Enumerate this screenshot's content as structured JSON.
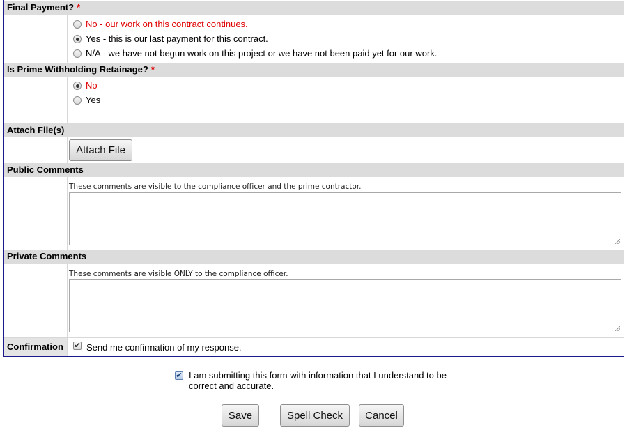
{
  "final_payment": {
    "label": "Final Payment?",
    "required_mark": "*",
    "options": [
      {
        "label": "No - our work on this contract continues.",
        "selected": false
      },
      {
        "label": "Yes - this is our last payment for this contract.",
        "selected": true
      },
      {
        "label": "N/A - we have not begun work on this project or we have not been paid yet for our work.",
        "selected": false
      }
    ]
  },
  "retainage": {
    "label": "Is Prime Withholding Retainage?",
    "required_mark": "*",
    "options": [
      {
        "label": "No",
        "selected": true
      },
      {
        "label": "Yes",
        "selected": false
      }
    ]
  },
  "attach": {
    "label": "Attach File(s)",
    "button_label": "Attach File"
  },
  "public_comments": {
    "label": "Public Comments",
    "hint": "These comments are visible to the compliance officer and the prime contractor.",
    "value": ""
  },
  "private_comments": {
    "label": "Private Comments",
    "hint": "These comments are visible ONLY to the compliance officer.",
    "value": ""
  },
  "confirmation": {
    "label": "Confirmation",
    "checkbox_label": "Send me confirmation of my response.",
    "checked": true
  },
  "attestation": {
    "text_line1": "I am submitting this form with information that I understand to be",
    "text_line2": "correct and accurate.",
    "checked": true
  },
  "actions": {
    "save_label": "Save",
    "spell_check_label": "Spell Check",
    "cancel_label": "Cancel"
  }
}
